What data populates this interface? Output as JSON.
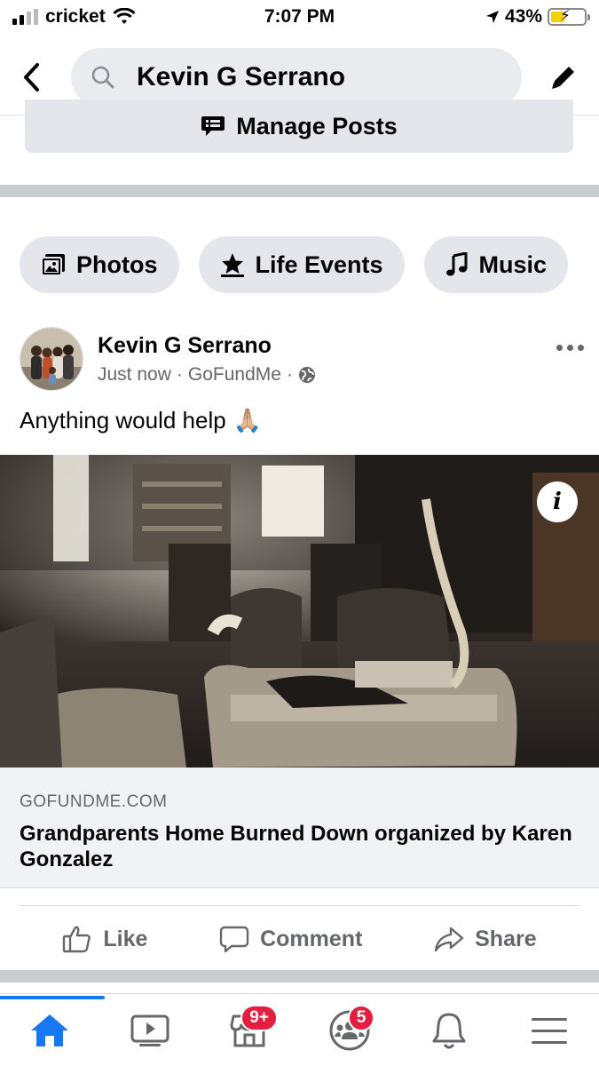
{
  "status_bar": {
    "carrier": "cricket",
    "time": "7:07 PM",
    "battery": "43%",
    "battery_level": 0.43
  },
  "search": {
    "query": "Kevin G Serrano",
    "icons": [
      "back-icon",
      "search-icon",
      "edit-pencil-icon"
    ]
  },
  "manage_posts": {
    "label": "Manage Posts",
    "icon": "chat-list-icon"
  },
  "chips": [
    {
      "label": "Photos",
      "icon": "photos-icon"
    },
    {
      "label": "Life Events",
      "icon": "life-event-star-icon"
    },
    {
      "label": "Music",
      "icon": "music-note-icon"
    }
  ],
  "post": {
    "author": "Kevin G Serrano",
    "time": "Just now",
    "source": "GoFundMe",
    "separator": "·",
    "privacy_icon": "globe-icon",
    "text": "Anything would help",
    "emoji": "🙏🏼",
    "link": {
      "domain": "GOFUNDME.COM",
      "title": "Grandparents Home Burned Down organized by Karen Gonzalez"
    },
    "info_label": "i"
  },
  "actions": [
    {
      "label": "Like",
      "icon": "thumbs-up-icon"
    },
    {
      "label": "Comment",
      "icon": "comment-bubble-icon"
    },
    {
      "label": "Share",
      "icon": "share-arrow-icon"
    }
  ],
  "tabs": [
    {
      "name": "home",
      "active": true
    },
    {
      "name": "watch"
    },
    {
      "name": "marketplace",
      "badge": "9+"
    },
    {
      "name": "groups",
      "badge": "5"
    },
    {
      "name": "notifications"
    },
    {
      "name": "menu"
    }
  ],
  "colors": {
    "accent": "#1877f2",
    "badge": "#e41e3f",
    "muted_text": "#65676b",
    "chip_bg": "#e4e6eb"
  }
}
